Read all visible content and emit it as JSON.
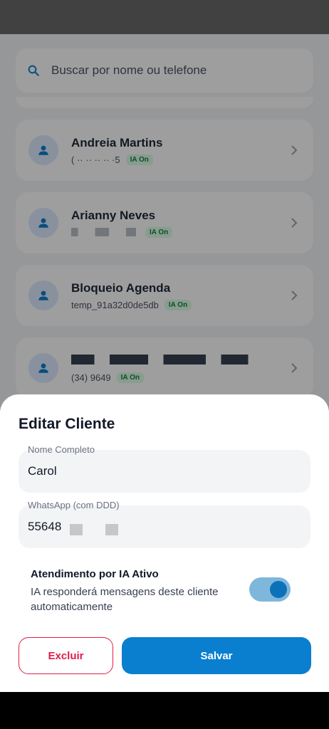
{
  "search": {
    "placeholder": "Buscar por nome ou telefone"
  },
  "clients": [
    {
      "name": "Andreia Martins",
      "phone": "( ·· ·· ·· ·· ·5",
      "badge": "IA On"
    },
    {
      "name": "Arianny Neves",
      "phone": "",
      "badge": "IA On"
    },
    {
      "name": "Bloqueio Agenda",
      "phone": "temp_91a32d0de5db",
      "badge": "IA On"
    },
    {
      "name": "",
      "phone": "(34) 9649",
      "badge": "IA On"
    }
  ],
  "sheet": {
    "title": "Editar Cliente",
    "name_label": "Nome Completo",
    "name_value": "Carol",
    "whatsapp_label": "WhatsApp (com DDD)",
    "whatsapp_value": "55648",
    "ia_title": "Atendimento por IA Ativo",
    "ia_description": "IA responderá mensagens deste cliente automaticamente",
    "ia_enabled": true,
    "delete_label": "Excluir",
    "save_label": "Salvar"
  },
  "colors": {
    "accent": "#0a7fcf",
    "danger": "#e11d48",
    "badge_green": "#15803d"
  }
}
